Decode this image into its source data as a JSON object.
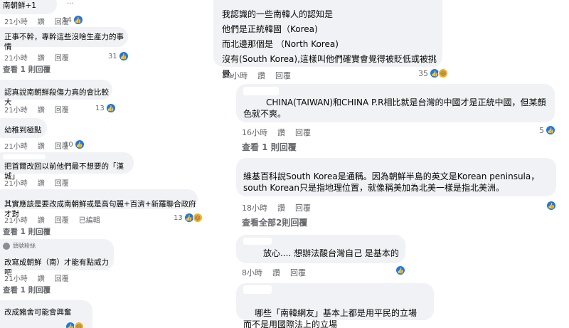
{
  "left_comments": [
    {
      "text": "南朝鮮+1",
      "time": "21小時",
      "like": "讚",
      "reply": "回覆",
      "count": "14"
    },
    {
      "text": "正事不幹，專幹這些沒啥生產力的事情",
      "time": "21小時",
      "like": "讚",
      "reply": "回覆",
      "count": "31",
      "view_replies": "查看 1 則回覆"
    },
    {
      "text": "認真說南朝鮮殺傷力真的會比較大",
      "time": "21小時",
      "like": "讚",
      "reply": "回覆",
      "count": "13"
    },
    {
      "text": "幼稚到極點",
      "time": "21小時",
      "like": "讚",
      "reply": "回覆",
      "count": "10"
    },
    {
      "text": "把首爾改回以前他們最不想要的「漢城」",
      "time": "21小時",
      "like": "讚",
      "reply": "回覆",
      "count": ""
    },
    {
      "text": "其實應該是要改成南朝鮮或是高句麗+百濟+新羅聯合政府才對",
      "time": "21小時",
      "like": "讚",
      "reply": "回覆",
      "edited": "已編輯",
      "count": "13",
      "view_replies": "查看 1 則回覆"
    },
    {
      "badge": "頭號粉絲",
      "text": "改寫成朝鮮（南）才能有點威力吧",
      "time": "21小時",
      "like": "讚",
      "reply": "回覆",
      "count": "",
      "view_replies": "查看 1 則回覆"
    },
    {
      "text": "改成豬舍可能會興奮",
      "time": "",
      "like": "",
      "reply": "",
      "count": ""
    }
  ],
  "right_comments": [
    {
      "text": "我認識的一些南韓人的認知是\n他們是正統韓國（Korea)\n而北邊那個是 （North Korea)\n沒有(South Korea),這樣叫他們確實會覺得被貶低或被挑釁。",
      "time": "20小時",
      "like": "讚",
      "reply": "回覆",
      "count": "35"
    },
    {
      "text": "CHINA(TAIWAN)和CHINA P.R相比就是台灣的中國才是正統中國，但某顏色就不爽。",
      "time": "16小時",
      "like": "讚",
      "reply": "回覆",
      "count": "5",
      "view_replies": "查看 1 則回覆"
    },
    {
      "text": "維基百科說South Korea是通稱。因為朝鮮半島的英文是Korean peninsula，south Korean只是指地理位置，就像稱美加為北美一樣是指北美洲。",
      "time": "18小時",
      "like": "讚",
      "reply": "回覆",
      "count": "",
      "view_replies": "查看全部2則回覆"
    },
    {
      "text": "放心.... 想辦法酸台灣自己 是基本的",
      "time": "8小時",
      "like": "讚",
      "reply": "回覆",
      "count": ""
    },
    {
      "text": "哪些「南韓網友」基本上都是用平民的立場\n而不是用國際法上的立場",
      "time": "",
      "like": "",
      "reply": "",
      "count": ""
    }
  ],
  "colors": {
    "bubble": "#f0f2f5",
    "meta": "#65676b",
    "like": "#1877f2",
    "haha": "#f7b125"
  }
}
